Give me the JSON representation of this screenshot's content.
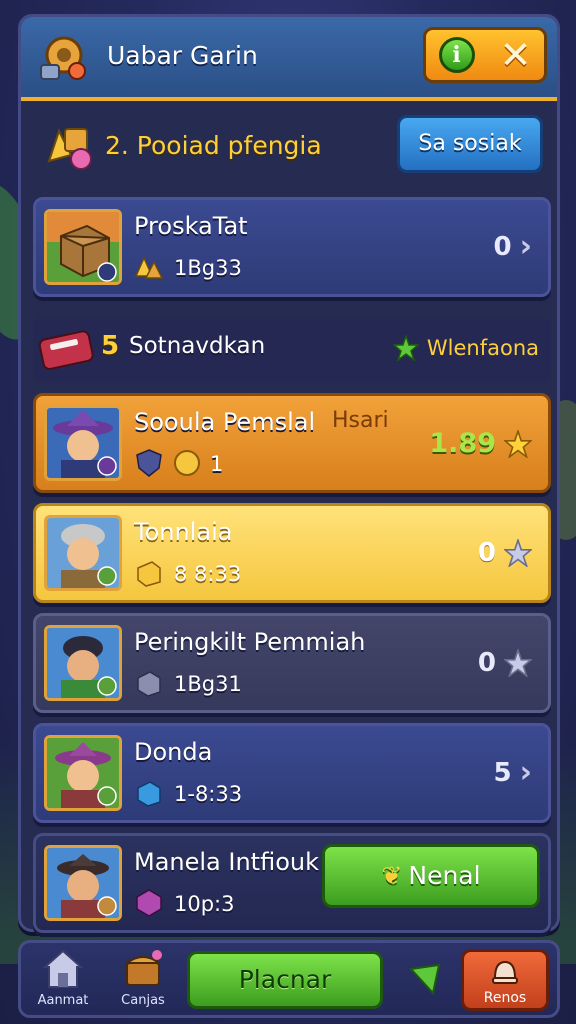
{
  "header": {
    "title": "Uabar Garin",
    "info_icon": "info-icon",
    "close_icon": "close-icon"
  },
  "section": {
    "title": "2. Pooiad pfengia",
    "button_label": "Sa sosiak"
  },
  "rows": [
    {
      "name": "ProskaTat",
      "sub": "1Bg33",
      "value": "0",
      "trail": "chevron"
    },
    {
      "name": "Sooula Pemslal",
      "tag": "Hsari",
      "badge": "1",
      "value": "1.89",
      "trail": "star"
    },
    {
      "name": "Tonnlaia",
      "sub": "8 8:33",
      "value": "0",
      "trail": "star"
    },
    {
      "name": "Peringkilt Pemmiah",
      "sub": "1Bg31",
      "value": "0",
      "trail": "star"
    },
    {
      "name": "Donda",
      "sub": "1-8:33",
      "value": "5",
      "trail": "chevron"
    }
  ],
  "mid_row": {
    "number": "5",
    "title": "Sotnavdkan",
    "right_label": "Wlenfaona"
  },
  "hero_row": {
    "name": "Manela Intfiouk",
    "sub": "10p:3",
    "button_label": "Nenal"
  },
  "bottom_nav": {
    "home_label": "Aanmat",
    "shop_label": "Canjas",
    "play_label": "Placnar",
    "rank_label": "Renos"
  },
  "colors": {
    "accent_gold": "#f0b02a",
    "panel_bg": "#262b52",
    "green_button": "#3c9e1f",
    "blue_button": "#2470c2",
    "orange_row": "#f2a23a",
    "yellow_row": "#f5c63e"
  }
}
